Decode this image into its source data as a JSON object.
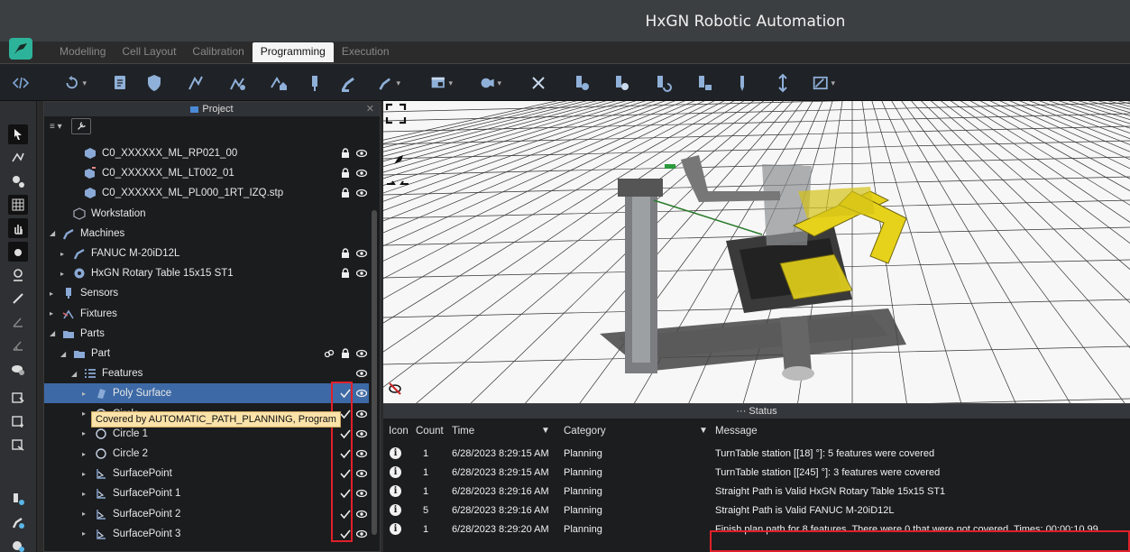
{
  "app": {
    "title": "HxGN Robotic Automation"
  },
  "tabs": [
    {
      "label": "Modelling"
    },
    {
      "label": "Cell Layout"
    },
    {
      "label": "Calibration"
    },
    {
      "label": "Programming",
      "active": true
    },
    {
      "label": "Execution"
    }
  ],
  "project": {
    "header": "Project",
    "items": [
      {
        "label": "C0_XXXXXX_ML_RP021_00",
        "indent": 2,
        "icon": "part-icon",
        "lock": true,
        "eye": true
      },
      {
        "label": "C0_XXXXXX_ML_LT002_01",
        "indent": 2,
        "icon": "part-edit-icon",
        "lock": true,
        "eye": true
      },
      {
        "label": "C0_XXXXXX_ML_PL000_1RT_IZQ.stp",
        "indent": 2,
        "icon": "part-icon",
        "lock": true,
        "eye": true
      },
      {
        "label": "Workstation",
        "indent": 1,
        "icon": "workstation-icon"
      },
      {
        "label": "Machines",
        "indent": 0,
        "icon": "robot-arm-icon",
        "expanded": true
      },
      {
        "label": "FANUC M-20iD12L",
        "indent": 1,
        "icon": "robot-arm-icon",
        "collapsed": true,
        "lock": true,
        "eye": true
      },
      {
        "label": "HxGN  Rotary Table 15x15 ST1",
        "indent": 1,
        "icon": "rotary-table-icon",
        "collapsed": true,
        "lock": true,
        "eye": true
      },
      {
        "label": "Sensors",
        "indent": 0,
        "icon": "sensor-icon",
        "collapsed": true
      },
      {
        "label": "Fixtures",
        "indent": 0,
        "icon": "fixture-icon",
        "collapsed": true
      },
      {
        "label": "Parts",
        "indent": 0,
        "icon": "part-folder-icon",
        "expanded": true
      },
      {
        "label": "Part",
        "indent": 1,
        "icon": "part-folder-icon",
        "expanded": true,
        "link": true,
        "lock": true,
        "eye": true
      },
      {
        "label": "Features",
        "indent": 2,
        "icon": "list-icon",
        "expanded": true,
        "eye": true
      },
      {
        "label": "Poly Surface",
        "indent": 3,
        "icon": "surface-icon",
        "collapsed": true,
        "check": true,
        "eye": true,
        "selected": true
      },
      {
        "label": "Circle",
        "indent": 3,
        "icon": "circle-icon",
        "collapsed": true,
        "check": true,
        "eye": true
      },
      {
        "label": "Circle 1",
        "indent": 3,
        "icon": "circle-icon",
        "collapsed": true,
        "check": true,
        "eye": true
      },
      {
        "label": "Circle 2",
        "indent": 3,
        "icon": "circle-icon",
        "collapsed": true,
        "check": true,
        "eye": true
      },
      {
        "label": "SurfacePoint",
        "indent": 3,
        "icon": "surface-point-icon",
        "collapsed": true,
        "check": true,
        "eye": true
      },
      {
        "label": "SurfacePoint 1",
        "indent": 3,
        "icon": "surface-point-icon",
        "collapsed": true,
        "check": true,
        "eye": true
      },
      {
        "label": "SurfacePoint 2",
        "indent": 3,
        "icon": "surface-point-icon",
        "collapsed": true,
        "check": true,
        "eye": true
      },
      {
        "label": "SurfacePoint 3",
        "indent": 3,
        "icon": "surface-point-icon",
        "collapsed": true,
        "check": true,
        "eye": true
      }
    ],
    "tooltip": "Covered by AUTOMATIC_PATH_PLANNING, Program"
  },
  "status": {
    "header": "Status",
    "columns": {
      "icon": "Icon",
      "count": "Count",
      "time": "Time",
      "category": "Category",
      "message": "Message"
    },
    "rows": [
      {
        "count": "1",
        "time": "6/28/2023 8:29:15 AM",
        "category": "Planning",
        "message": "TurnTable station [[18] °]: 5 features were covered"
      },
      {
        "count": "1",
        "time": "6/28/2023 8:29:15 AM",
        "category": "Planning",
        "message": "TurnTable station [[245] °]: 3 features were covered"
      },
      {
        "count": "1",
        "time": "6/28/2023 8:29:16 AM",
        "category": "Planning",
        "message": "Straight Path is Valid HxGN  Rotary Table 15x15 ST1"
      },
      {
        "count": "5",
        "time": "6/28/2023 8:29:16 AM",
        "category": "Planning",
        "message": "Straight Path is Valid FANUC M-20iD12L"
      },
      {
        "count": "1",
        "time": "6/28/2023 8:29:20 AM",
        "category": "Planning",
        "message": "Finish plan path for 8 features. There were 0 that were not covered. Times: 00:00:10.99"
      }
    ]
  },
  "colors": {
    "accent": "#3d6aa6",
    "highlight": "#e0202a",
    "robot": "#e6d21a"
  }
}
